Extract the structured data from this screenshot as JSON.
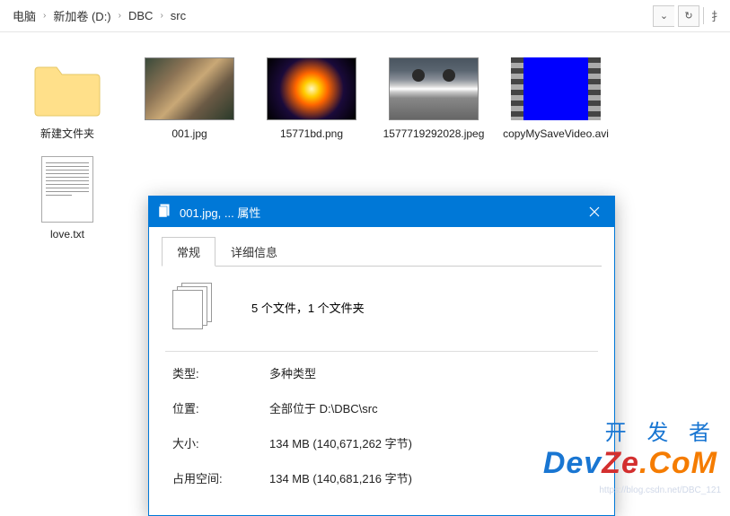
{
  "breadcrumb": {
    "segments": [
      "电脑",
      "新加卷 (D:)",
      "DBC",
      "src"
    ]
  },
  "files": [
    {
      "name": "新建文件夹",
      "kind": "folder"
    },
    {
      "name": "001.jpg",
      "kind": "image1"
    },
    {
      "name": "15771bd.png",
      "kind": "image2"
    },
    {
      "name": "1577719292028.jpeg",
      "kind": "image3"
    },
    {
      "name": "copyMySaveVideo.avi",
      "kind": "video"
    },
    {
      "name": "love.txt",
      "kind": "text"
    }
  ],
  "dialog": {
    "title": "001.jpg, ... 属性",
    "tabs": {
      "general": "常规",
      "details": "详细信息"
    },
    "summary": "5 个文件，1 个文件夹",
    "rows": {
      "type_label": "类型:",
      "type_value": "多种类型",
      "location_label": "位置:",
      "location_value": "全部位于 D:\\DBC\\src",
      "size_label": "大小:",
      "size_value": "134 MB (140,671,262 字节)",
      "disk_label": "占用空间:",
      "disk_value": "134 MB (140,681,216 字节)"
    }
  },
  "watermark": "https://blog.csdn.net/DBC_121",
  "brand": {
    "top": "开 发 者",
    "text": "DevZe.CoM"
  }
}
